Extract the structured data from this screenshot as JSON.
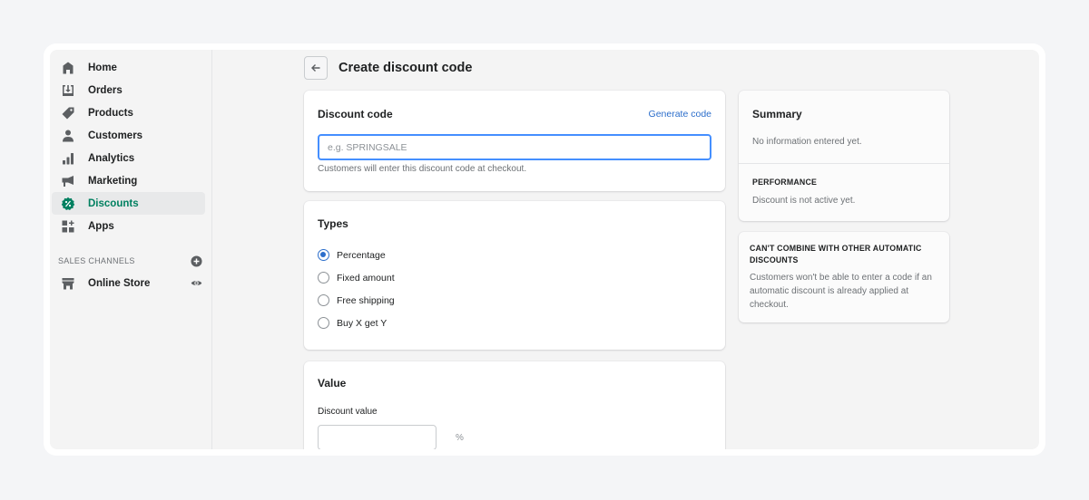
{
  "sidebar": {
    "items": [
      {
        "label": "Home",
        "icon": "home-icon"
      },
      {
        "label": "Orders",
        "icon": "orders-icon"
      },
      {
        "label": "Products",
        "icon": "tag-icon"
      },
      {
        "label": "Customers",
        "icon": "person-icon"
      },
      {
        "label": "Analytics",
        "icon": "bar-chart-icon"
      },
      {
        "label": "Marketing",
        "icon": "megaphone-icon"
      },
      {
        "label": "Discounts",
        "icon": "discount-badge-icon",
        "active": true
      },
      {
        "label": "Apps",
        "icon": "apps-icon"
      }
    ],
    "sales_channels": {
      "title": "SALES CHANNELS",
      "add_icon": "plus-circle-icon",
      "items": [
        {
          "label": "Online Store",
          "icon": "store-icon",
          "trailing_icon": "eye-icon"
        }
      ]
    }
  },
  "header": {
    "back_icon": "arrow-left-icon",
    "title": "Create discount code"
  },
  "discount_code_card": {
    "title": "Discount code",
    "generate_link": "Generate code",
    "input_value": "",
    "input_placeholder": "e.g. SPRINGSALE",
    "help_text": "Customers will enter this discount code at checkout."
  },
  "types_card": {
    "title": "Types",
    "options": [
      {
        "label": "Percentage",
        "checked": true
      },
      {
        "label": "Fixed amount",
        "checked": false
      },
      {
        "label": "Free shipping",
        "checked": false
      },
      {
        "label": "Buy X get Y",
        "checked": false
      }
    ]
  },
  "value_card": {
    "title": "Value",
    "field_label": "Discount value",
    "input_value": "",
    "suffix": "%"
  },
  "summary_card": {
    "title": "Summary",
    "empty_text": "No information entered yet.",
    "performance_title": "PERFORMANCE",
    "performance_text": "Discount is not active yet."
  },
  "combine_card": {
    "title": "CAN'T COMBINE WITH OTHER AUTOMATIC DISCOUNTS",
    "text": "Customers won't be able to enter a code if an automatic discount is already applied at checkout."
  },
  "colors": {
    "accent_blue": "#2c6ecb",
    "active_green": "#008060",
    "focus_border": "#458fff"
  }
}
